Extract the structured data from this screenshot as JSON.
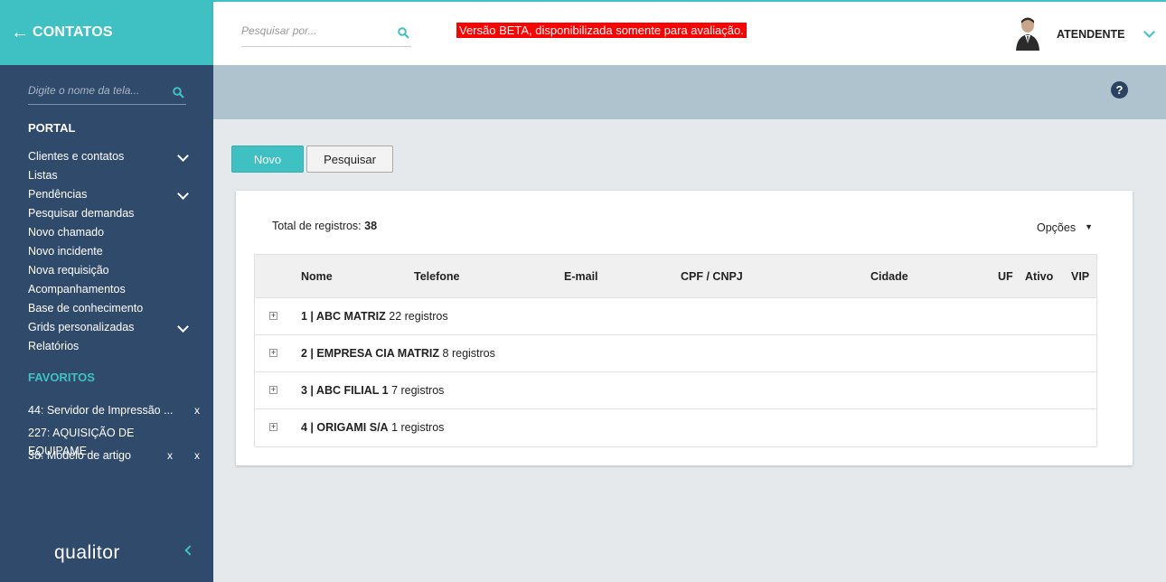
{
  "sidebar": {
    "title": "CONTATOS",
    "search_placeholder": "Digite o nome da tela...",
    "portal_label": "PORTAL",
    "menu": [
      {
        "label": "Clientes e contatos",
        "expandable": true
      },
      {
        "label": "Listas",
        "expandable": false
      },
      {
        "label": "Pendências",
        "expandable": true
      },
      {
        "label": "Pesquisar demandas",
        "expandable": false
      },
      {
        "label": "Novo chamado",
        "expandable": false
      },
      {
        "label": "Novo incidente",
        "expandable": false
      },
      {
        "label": "Nova requisição",
        "expandable": false
      },
      {
        "label": "Acompanhamentos",
        "expandable": false
      },
      {
        "label": "Base de conhecimento",
        "expandable": false
      },
      {
        "label": "Grids personalizadas",
        "expandable": true
      },
      {
        "label": "Relatórios",
        "expandable": false
      }
    ],
    "favorites_label": "FAVORITOS",
    "favorites": [
      {
        "label": "44: Servidor de Impressão ...",
        "close": "x"
      },
      {
        "label": "227: AQUISIÇÃO DE EQUIPAME...",
        "close": ""
      },
      {
        "label": "38: Modelo de artigo",
        "close": "x",
        "extra": "x"
      }
    ],
    "logo": "qualitor"
  },
  "topbar": {
    "search_placeholder": "Pesquisar por...",
    "beta_notice": "Versão BETA, disponibilizada somente para avaliação.",
    "user_name": "ATENDENTE"
  },
  "band": {
    "help_label": "?"
  },
  "actions": {
    "novo": "Novo",
    "pesquisar": "Pesquisar"
  },
  "panel": {
    "total_label": "Total de registros:",
    "total_value": "38",
    "options_label": "Opções",
    "options_caret": "▼",
    "columns": [
      "Nome",
      "Telefone",
      "E-mail",
      "CPF / CNPJ",
      "Cidade",
      "UF",
      "Ativo",
      "VIP"
    ],
    "groups": [
      {
        "name": "1 | ABC MATRIZ",
        "count": "22 registros"
      },
      {
        "name": "2 | EMPRESA CIA MATRIZ",
        "count": "8 registros"
      },
      {
        "name": "3 | ABC FILIAL 1",
        "count": "7 registros"
      },
      {
        "name": "4 | ORIGAMI S/A",
        "count": "1 registros"
      }
    ]
  },
  "colors": {
    "accent": "#3fc1c3",
    "sidebar": "#304a6b",
    "band": "#afc3cf",
    "beta": "#ff0000"
  },
  "icons": [
    "arrow-left-icon",
    "search-icon",
    "chevron-down-icon",
    "user-avatar-icon",
    "help-icon",
    "expand-plus-icon",
    "chevron-left-icon"
  ]
}
